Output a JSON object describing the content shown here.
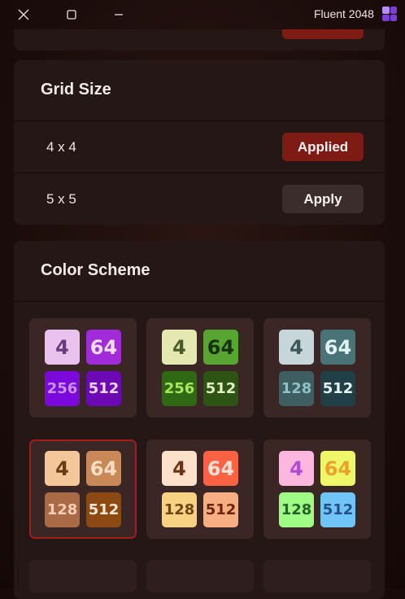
{
  "window": {
    "title": "Fluent 2048",
    "close_icon": "close-icon",
    "maximize_icon": "maximize-icon",
    "minimize_icon": "minimize-icon"
  },
  "grid_size": {
    "heading": "Grid Size",
    "options": [
      {
        "label": "4 x 4",
        "button": "Applied"
      },
      {
        "label": "5 x 5",
        "button": "Apply"
      }
    ]
  },
  "color_scheme": {
    "heading": "Color Scheme",
    "schemes": [
      {
        "tiles": [
          {
            "value": "4",
            "bg": "#e9c2ee",
            "fg": "#6a3a7c"
          },
          {
            "value": "64",
            "bg": "#a12bd8",
            "fg": "#f4dcfb"
          },
          {
            "value": "256",
            "bg": "#7c09db",
            "fg": "#c990f6"
          },
          {
            "value": "512",
            "bg": "#6d08b5",
            "fg": "#efd8fb"
          }
        ]
      },
      {
        "tiles": [
          {
            "value": "4",
            "bg": "#e5e8b0",
            "fg": "#4a5a2a"
          },
          {
            "value": "64",
            "bg": "#58a532",
            "fg": "#17330d"
          },
          {
            "value": "256",
            "bg": "#2f6914",
            "fg": "#a8e65e"
          },
          {
            "value": "512",
            "bg": "#2d5412",
            "fg": "#e3f0c4"
          }
        ]
      },
      {
        "tiles": [
          {
            "value": "4",
            "bg": "#c7d7d9",
            "fg": "#3b585b"
          },
          {
            "value": "64",
            "bg": "#4a7377",
            "fg": "#dff2f2"
          },
          {
            "value": "128",
            "bg": "#3e5e61",
            "fg": "#8cc1c6"
          },
          {
            "value": "512",
            "bg": "#203f47",
            "fg": "#e8f5f6"
          }
        ]
      },
      {
        "tiles": [
          {
            "value": "4",
            "bg": "#f3c79a",
            "fg": "#6a3c15"
          },
          {
            "value": "64",
            "bg": "#c88956",
            "fg": "#f6ddc3"
          },
          {
            "value": "128",
            "bg": "#a96a45",
            "fg": "#f7cfb6"
          },
          {
            "value": "512",
            "bg": "#8c4a12",
            "fg": "#fbe8d6"
          }
        ]
      },
      {
        "tiles": [
          {
            "value": "4",
            "bg": "#fde1cb",
            "fg": "#6e3118"
          },
          {
            "value": "64",
            "bg": "#fb6243",
            "fg": "#ffe0d6"
          },
          {
            "value": "128",
            "bg": "#f8d283",
            "fg": "#6b4610"
          },
          {
            "value": "512",
            "bg": "#f6ae82",
            "fg": "#6c2509"
          }
        ]
      },
      {
        "tiles": [
          {
            "value": "4",
            "bg": "#fbb7dd",
            "fg": "#b24ad4"
          },
          {
            "value": "64",
            "bg": "#eef76a",
            "fg": "#e9a22a"
          },
          {
            "value": "128",
            "bg": "#9dfd84",
            "fg": "#28622b"
          },
          {
            "value": "512",
            "bg": "#70c5f6",
            "fg": "#244f8a"
          }
        ]
      }
    ],
    "selected_index": 3
  }
}
